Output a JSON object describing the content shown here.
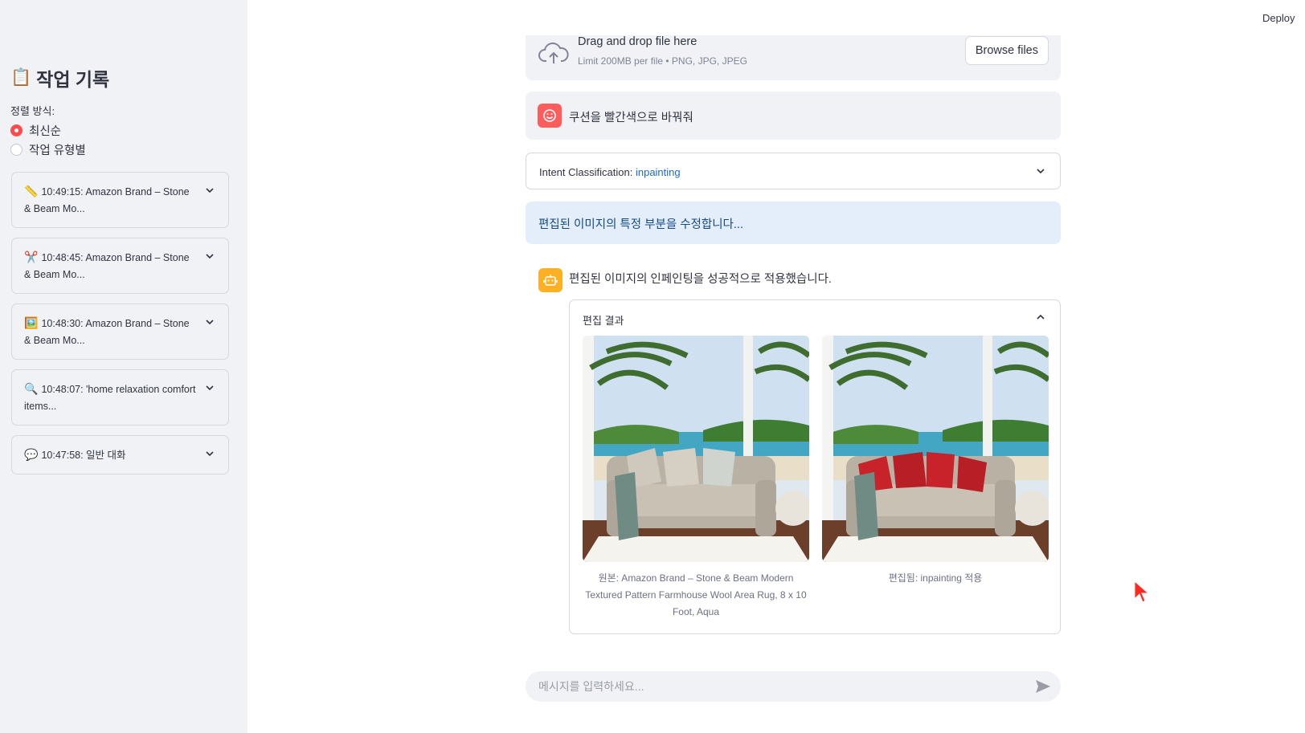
{
  "app": {
    "deploy_label": "Deploy"
  },
  "sidebar": {
    "title": "작업 기록",
    "title_icon": "clipboard-icon",
    "sort_label": "정렬 방식:",
    "sort_options": [
      {
        "label": "최신순",
        "selected": true
      },
      {
        "label": "작업 유형별",
        "selected": false
      }
    ],
    "history": [
      {
        "icon": "ruler-icon",
        "emoji": "📏",
        "label": "10:49:15: Amazon Brand – Stone & Beam Mo..."
      },
      {
        "icon": "scissors-icon",
        "emoji": "✂️",
        "label": "10:48:45: Amazon Brand – Stone & Beam Mo..."
      },
      {
        "icon": "picture-icon",
        "emoji": "🖼️",
        "label": "10:48:30: Amazon Brand – Stone & Beam Mo..."
      },
      {
        "icon": "magnifier-icon",
        "emoji": "🔍",
        "label": "10:48:07: 'home relaxation comfort items..."
      },
      {
        "icon": "speech-bubble-icon",
        "emoji": "💬",
        "label": "10:47:58: 일반 대화"
      }
    ]
  },
  "uploader": {
    "drag_text": "Drag and drop file here",
    "limit_text": "Limit 200MB per file • PNG, JPG, JPEG",
    "browse_label": "Browse files"
  },
  "chat": {
    "user_message": "쿠션을 빨간색으로 바꿔줘",
    "intent_label": "Intent Classification:",
    "intent_value": "inpainting",
    "info_message": "편집된 이미지의 특정 부분을 수정합니다...",
    "assistant_message": "편집된 이미지의 인페인팅을 성공적으로 적용했습니다.",
    "result_header": "편집 결과",
    "original_caption": "원본: Amazon Brand – Stone & Beam Modern Textured Pattern Farmhouse Wool Area Rug, 8 x 10 Foot, Aqua",
    "edited_caption": "편집됨: inpainting 적용",
    "input_placeholder": "메시지를 입력하세요..."
  },
  "colors": {
    "accent": "#ff4b4b",
    "sidebar_bg": "#f0f2f6",
    "info_bg": "#e4eefb",
    "info_text": "#134a86",
    "link": "#1c6bc7",
    "cushion_original": "#cfc9bd",
    "cushion_edited": "#c8232b"
  }
}
